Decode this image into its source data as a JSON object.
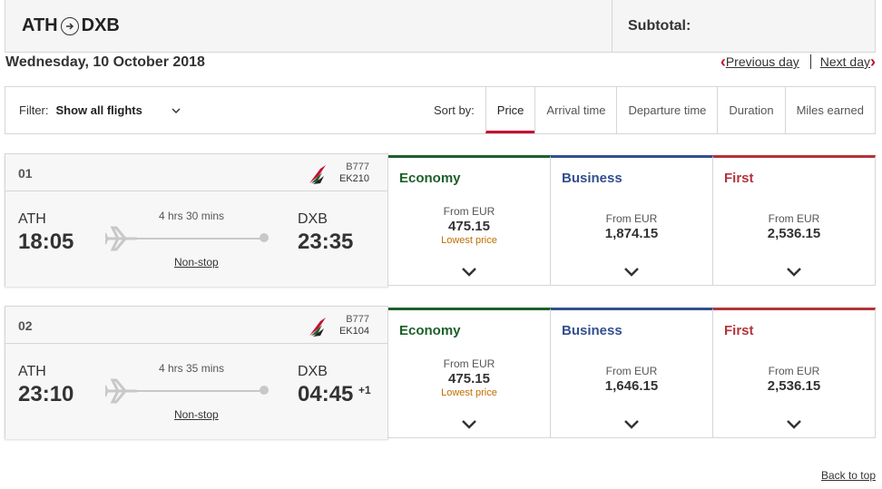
{
  "header": {
    "origin": "ATH",
    "destination": "DXB",
    "subtotal_label": "Subtotal:"
  },
  "date": "Wednesday, 10 October 2018",
  "daynav": {
    "previous": "Previous day",
    "next": "Next day"
  },
  "filter": {
    "label": "Filter:",
    "value": "Show all flights"
  },
  "sort": {
    "label": "Sort by:",
    "options": [
      "Price",
      "Arrival time",
      "Departure time",
      "Duration",
      "Miles earned"
    ],
    "active": "Price"
  },
  "flights": [
    {
      "number": "01",
      "aircraft": "B777",
      "flight_code": "EK210",
      "origin": "ATH",
      "depart": "18:05",
      "destination": "DXB",
      "arrive": "23:35",
      "day_offset": "",
      "duration": "4 hrs 30 mins",
      "stops": "Non-stop",
      "fares": [
        {
          "class": "Economy",
          "from": "From EUR",
          "price": "475.15",
          "note": "Lowest price"
        },
        {
          "class": "Business",
          "from": "From EUR",
          "price": "1,874.15",
          "note": ""
        },
        {
          "class": "First",
          "from": "From EUR",
          "price": "2,536.15",
          "note": ""
        }
      ]
    },
    {
      "number": "02",
      "aircraft": "B777",
      "flight_code": "EK104",
      "origin": "ATH",
      "depart": "23:10",
      "destination": "DXB",
      "arrive": "04:45",
      "day_offset": "+1",
      "duration": "4 hrs 35 mins",
      "stops": "Non-stop",
      "fares": [
        {
          "class": "Economy",
          "from": "From EUR",
          "price": "475.15",
          "note": "Lowest price"
        },
        {
          "class": "Business",
          "from": "From EUR",
          "price": "1,646.15",
          "note": ""
        },
        {
          "class": "First",
          "from": "From EUR",
          "price": "2,536.15",
          "note": ""
        }
      ]
    }
  ],
  "back_to_top": "Back to top",
  "colors": {
    "accent": "#c60c30",
    "economy": "#1e5f2b",
    "business": "#334f8e",
    "first": "#b3333b",
    "lowest": "#c06d00"
  }
}
